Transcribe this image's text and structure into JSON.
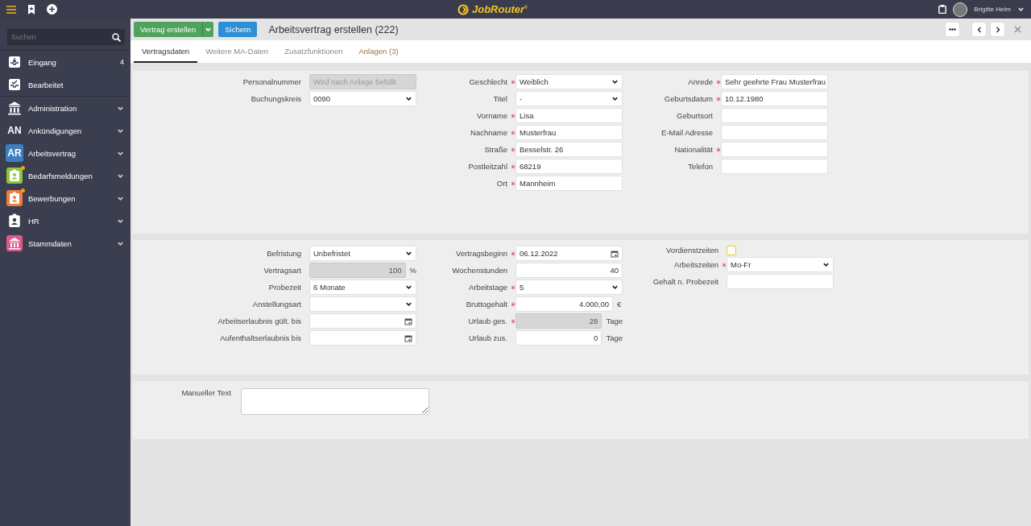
{
  "topbar": {
    "logo": "JobRouter$^{®}$",
    "user": "Brigitte Helm"
  },
  "sidebar": {
    "search": {
      "placeholder": "Suchen"
    },
    "favorites": [
      {
        "label": "Eingang",
        "count": "4",
        "kind": "inbox"
      },
      {
        "label": "Bearbeitet",
        "kind": "done"
      }
    ],
    "menu": [
      {
        "label": "Administration",
        "kind": "bank",
        "expanded": false,
        "notification": false
      },
      {
        "label": "Ankündigungen",
        "kind": "abbr",
        "abbr": "AN",
        "expanded": false,
        "notification": false
      },
      {
        "label": "Arbeitsvertrag",
        "kind": "tile-abbr",
        "abbr": "AR",
        "color": "#3d7ebf",
        "expanded": false,
        "notification": false
      },
      {
        "label": "Bedarfsmeldungen",
        "kind": "tile-badge",
        "color": "#8cc63e",
        "expanded": false,
        "notification": true
      },
      {
        "label": "Bewerbungen",
        "kind": "tile-badge",
        "color": "#f27b3a",
        "expanded": false,
        "notification": true
      },
      {
        "label": "HR",
        "kind": "badge",
        "expanded": false,
        "notification": false
      },
      {
        "label": "Stammdaten",
        "kind": "tile-bank",
        "color": "#e0588a",
        "expanded": false,
        "notification": false
      }
    ]
  },
  "toolbar": {
    "primary_button": "Vertrag erstellen",
    "save_button": "Sichern",
    "title": "Arbeitsvertrag erstellen (222)"
  },
  "tabs": [
    {
      "label": "Vertragsdaten",
      "selected": true,
      "highlighted": false
    },
    {
      "label": "Weitere MA-Daten",
      "selected": false,
      "highlighted": false
    },
    {
      "label": "Zusatzfunktionen",
      "selected": false,
      "highlighted": false
    },
    {
      "label": "Anlagen (3)",
      "selected": false,
      "highlighted": true
    }
  ],
  "panels": [
    {
      "columns": [
        [
          {
            "label": "Personalnummer",
            "required": false,
            "kind": "readonly",
            "placeholder": "Wird nach Anlage befüllt"
          },
          {
            "label": "Buchungskreis",
            "required": false,
            "kind": "select",
            "value": "0090"
          }
        ],
        [
          {
            "label": "Geschlecht",
            "required": true,
            "kind": "select",
            "value": "Weiblich"
          },
          {
            "label": "Titel",
            "required": false,
            "kind": "select",
            "value": "-"
          },
          {
            "label": "Vorname",
            "required": true,
            "kind": "text",
            "value": "Lisa"
          },
          {
            "label": "Nachname",
            "required": true,
            "kind": "text",
            "value": "Musterfrau"
          },
          {
            "label": "Straße",
            "required": true,
            "kind": "text",
            "value": "Besselstr. 26"
          },
          {
            "label": "Postleitzahl",
            "required": true,
            "kind": "text",
            "value": "68219"
          },
          {
            "label": "Ort",
            "required": true,
            "kind": "text",
            "value": "Mannheim"
          }
        ],
        [
          {
            "label": "Anrede",
            "required": true,
            "kind": "text",
            "value": "Sehr geehrte Frau Musterfrau"
          },
          {
            "label": "Geburtsdatum",
            "required": true,
            "kind": "text",
            "value": "10.12.1980"
          },
          {
            "label": "Geburtsort",
            "required": false,
            "kind": "text"
          },
          {
            "label": "E-Mail Adresse",
            "required": false,
            "kind": "text"
          },
          {
            "label": "Nationalität",
            "required": true,
            "kind": "text"
          },
          {
            "label": "Telefon",
            "required": false,
            "kind": "text"
          }
        ]
      ]
    },
    {
      "columns": [
        [
          {
            "label": "Befristung",
            "required": false,
            "kind": "select",
            "value": "Unbefristet"
          },
          {
            "label": "Vertragsart",
            "required": false,
            "kind": "readonly-number",
            "value": "100",
            "unit": "%"
          },
          {
            "label": "Probezeit",
            "required": false,
            "kind": "select",
            "value": "6 Monate"
          },
          {
            "label": "Anstellungsart",
            "required": false,
            "kind": "select"
          },
          {
            "label": "Arbeitserlaubnis gült. bis",
            "required": false,
            "kind": "date"
          },
          {
            "label": "Aufenthaltserlaubnis bis",
            "required": false,
            "kind": "date"
          }
        ],
        [
          {
            "label": "Vertragsbeginn",
            "required": true,
            "kind": "date",
            "value": "06.12.2022"
          },
          {
            "label": "Wochenstunden",
            "required": false,
            "kind": "number",
            "value": "40"
          },
          {
            "label": "Arbeitstage",
            "required": true,
            "kind": "select",
            "value": "5"
          },
          {
            "label": "Bruttogehalt",
            "required": true,
            "kind": "number",
            "value": "4.000,00",
            "unit": "€"
          },
          {
            "label": "Urlaub ges.",
            "required": true,
            "kind": "readonly-number",
            "value": "28",
            "unit": "Tage"
          },
          {
            "label": "Urlaub zus.",
            "required": false,
            "kind": "number",
            "value": "0",
            "unit": "Tage"
          }
        ],
        [
          {
            "label": "Vordienstzeiten",
            "required": false,
            "kind": "checkbox",
            "checked": false
          },
          {
            "label": "Arbeitszeiten",
            "required": true,
            "kind": "select",
            "value": "Mo-Fr"
          },
          {
            "label": "Gehalt n. Probezeit",
            "required": false,
            "kind": "text"
          }
        ]
      ]
    }
  ],
  "notes": {
    "label": "Manueller Text"
  }
}
